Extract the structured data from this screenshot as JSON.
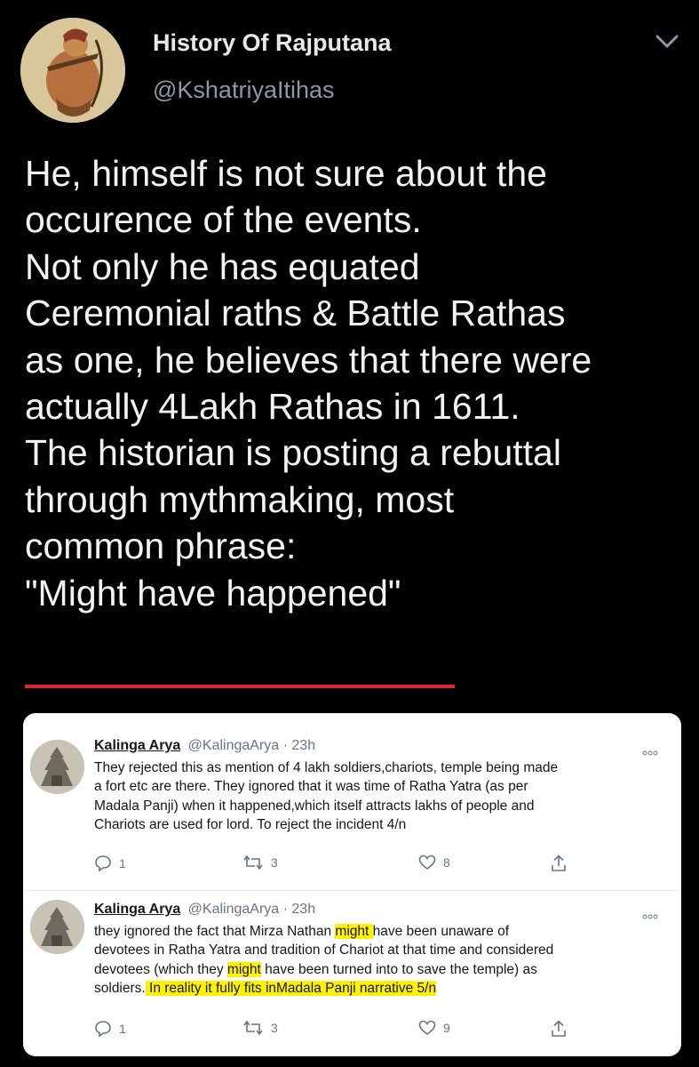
{
  "author": {
    "name": "History Of Rajputana",
    "handle": "@KshatriyaItihas"
  },
  "tweet": {
    "lines": [
      "He, himself is not sure about the",
      "occurence of the events.",
      "Not only he has equated",
      "Ceremonial raths & Battle Rathas",
      "as one, he believes that there were",
      "actually 4Lakh Rathas in 1611.",
      "The historian is posting a rebuttal",
      "through mythmaking, most",
      "common phrase:",
      "\"Might have happened\""
    ]
  },
  "embedded_replies": [
    {
      "name": "Kalinga Arya",
      "meta": "@KalingaArya · 23h",
      "lines": [
        "They rejected this as mention of  4 lakh soldiers,chariots, temple being made",
        "a fort etc are there. They ignored that it was time of Ratha Yatra (as per",
        "Madala Panji) when it happened,which itself attracts lakhs of people and",
        "Chariots are used for lord. To reject the incident 4/n"
      ],
      "replies": "1",
      "retweets": "3",
      "likes": "8"
    },
    {
      "name": "Kalinga Arya",
      "meta": "@KalingaArya · 23h",
      "line1_a": "they ignored the fact that Mirza Nathan ",
      "line1_hl": "might ",
      "line1_b": "have been unaware of",
      "line2": "devotees in Ratha Yatra and tradition of Chariot at that time and considered",
      "line3_a": "devotees (which they ",
      "line3_hl": "might",
      "line3_b": " have been turned into to save the temple) as",
      "line4_a": "soldiers.",
      "line4_hl": " In reality it fully fits inMadala Panji narrative 5/n",
      "replies": "1",
      "retweets": "3",
      "likes": "9"
    }
  ],
  "colors": {
    "background": "#000000",
    "underline": "#e0242f",
    "highlight": "#fff200"
  },
  "icons": [
    "avatar-warrior",
    "chevron-down-icon",
    "more-dots-icon",
    "reply-icon",
    "retweet-icon",
    "like-icon",
    "share-icon"
  ]
}
